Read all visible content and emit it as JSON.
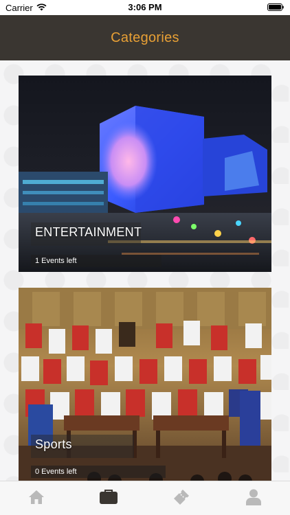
{
  "status_bar": {
    "carrier": "Carrier",
    "time": "3:06 PM"
  },
  "header": {
    "title": "Categories",
    "title_color": "#e8a035",
    "background": "#3a3631"
  },
  "categories": [
    {
      "title": "ENTERTAINMENT",
      "count": "1 Events left"
    },
    {
      "title": "Sports",
      "count": "0 Events left"
    }
  ],
  "tab_bar": {
    "items": [
      {
        "icon": "home-icon",
        "selected": false
      },
      {
        "icon": "categories-icon",
        "selected": true
      },
      {
        "icon": "ticket-icon",
        "selected": false
      },
      {
        "icon": "profile-icon",
        "selected": false
      }
    ],
    "selected_color": "#3a3631",
    "unselected_color": "#b9b9b9"
  }
}
